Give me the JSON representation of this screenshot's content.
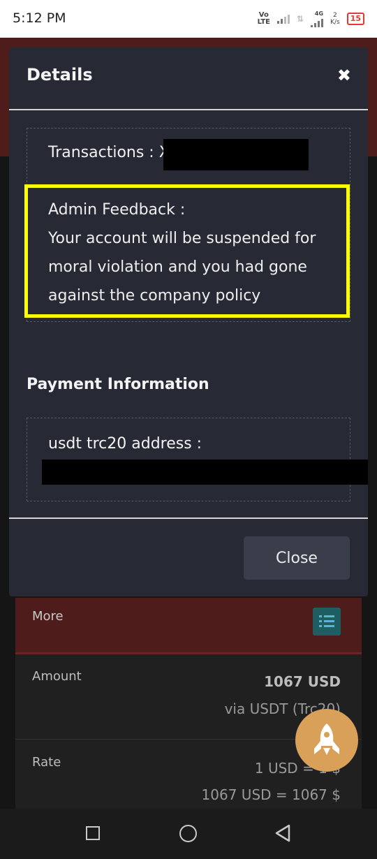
{
  "status_bar": {
    "time": "5:12 PM",
    "network_tag_top": "Vo",
    "network_tag_bottom": "LTE",
    "network_4g": "4G",
    "speed_value": "2",
    "speed_unit": "K/s",
    "battery": "15"
  },
  "modal": {
    "title": "Details",
    "close_icon": "close-icon",
    "transactions_label": "Transactions : X",
    "feedback_heading": "Admin Feedback :",
    "feedback_body": "Your account will be suspended for moral violation and you had gone against the company policy",
    "payment_title": "Payment Information",
    "address_label": "usdt trc20 address :",
    "close_button": "Close"
  },
  "background": {
    "more_label": "More",
    "amount_label": "Amount",
    "amount_value": "1067 USD",
    "amount_via": "via USDT (Trc20)",
    "rate_label": "Rate",
    "rate_value": "1 USD = 1 $",
    "rate_total": "1067 USD = 1067 $"
  },
  "icons": {
    "list": "list-icon",
    "rocket": "rocket-icon",
    "nav_recent": "square-icon",
    "nav_home": "circle-icon",
    "nav_back": "triangle-back-icon"
  },
  "colors": {
    "accent_yellow": "#ffff00",
    "modal_bg": "#272935",
    "maroon": "#4f1c1c",
    "fab": "#d9a05a"
  }
}
